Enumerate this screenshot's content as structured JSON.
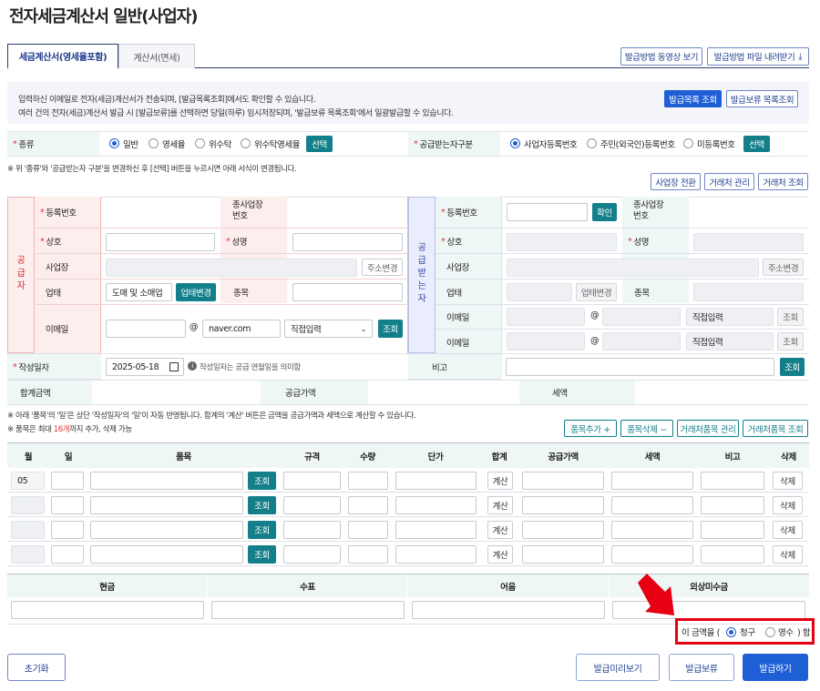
{
  "page": {
    "title": "전자세금계산서 일반(사업자)"
  },
  "tabs": [
    {
      "label": "세금계산서(영세율포함)"
    },
    {
      "label": "계산서(면세)"
    }
  ],
  "top_buttons": {
    "video": "발급방법 동영상 보기",
    "download": "발급방법 파일 내려받기"
  },
  "notice": {
    "line1": "입력하신 이메일로 전자(세금)계산서가 전송되며, [발급목록조회]에서도 확인할 수 있습니다.",
    "line2": "여러 건의 전자(세금)계산서 발급 시 [발급보류]를 선택하면 당일(하루) 임시저장되며, '발급보류 목록조회'에서 일괄발급할 수 있습니다.",
    "btn_list": "발급목록 조회",
    "btn_hold_list": "발급보류 목록조회"
  },
  "type_row": {
    "label": "종류",
    "options": [
      "일반",
      "영세율",
      "위수탁",
      "위수탁영세율"
    ],
    "select": "선택",
    "recv_label": "공급받는자구분",
    "recv_options": [
      "사업자등록번호",
      "주민(외국인)등록번호",
      "미등록번호"
    ],
    "recv_select": "선택"
  },
  "hint1": "※ 위 '종류'와 '공급받는자 구분'을 변경하신 후 [선택] 버튼을 누르시면 아래 서식이 변경됩니다.",
  "mid_buttons": {
    "biz_switch": "사업장 전환",
    "client_manage": "거래처 관리",
    "client_search": "거래처 조회"
  },
  "supplier": {
    "side": [
      "공",
      "급",
      "자"
    ],
    "reg_no": "등록번호",
    "sub_biz": "종사업장\n번호",
    "name": "상호",
    "ceo": "성명",
    "address": "사업장",
    "addr_btn": "주소변경",
    "biz_type": "업태",
    "biz_type_value": "도매 및 소매업",
    "biz_type_btn": "업태변경",
    "biz_item": "종목",
    "email": "이메일",
    "email_domain": "naver.com",
    "email_select": "직접입력",
    "email_btn": "조회"
  },
  "receiver": {
    "side": [
      "공",
      "급",
      "받",
      "는",
      "자"
    ],
    "reg_no": "등록번호",
    "confirm": "확인",
    "sub_biz": "종사업장\n번호",
    "name": "상호",
    "ceo": "성명",
    "address": "사업장",
    "addr_btn": "주소변경",
    "biz_type": "업태",
    "biz_type_btn": "업태변경",
    "biz_item": "종목",
    "email": "이메일",
    "email_select": "직접입력",
    "email_btn": "조회"
  },
  "write_date": {
    "label": "작성일자",
    "value": "2025-05-18",
    "note": "작성일자는 공급 연월일을 의미함",
    "remark_label": "비고",
    "remark_btn": "조회"
  },
  "totals": {
    "sum": "합계금액",
    "supply": "공급가액",
    "tax": "세액"
  },
  "hint2": "※ 아래 '품목'의 '일'은 상단 '작성일자'의 '일'이 자동 반영됩니다. 합계의 '계산' 버튼은 금액을 공급가액과 세액으로 계산할 수 있습니다.",
  "hint3_pre": "※ 품목은 최대 ",
  "hint3_num": "16개",
  "hint3_post": "까지 추가, 삭제 가능",
  "item_buttons": {
    "add": "품목추가 +",
    "del": "품목삭제 −",
    "manage": "거래처품목 관리",
    "search": "거래처품목 조회"
  },
  "items_table": {
    "headers": [
      "월",
      "일",
      "품목",
      "규격",
      "수량",
      "단가",
      "합계",
      "공급가액",
      "세액",
      "비고",
      "삭제"
    ],
    "rows": [
      {
        "month": "05"
      },
      {
        "month": ""
      },
      {
        "month": ""
      },
      {
        "month": ""
      }
    ],
    "lookup": "조회",
    "calc": "계산",
    "delete": "삭제"
  },
  "payment": {
    "headers": [
      "현금",
      "수표",
      "어음",
      "외상미수금"
    ]
  },
  "claim": {
    "pre": "이 금액을 (",
    "opt1": "청구",
    "opt2": "영수",
    "post": ") 함"
  },
  "bottom": {
    "reset": "초기화",
    "preview": "발급미리보기",
    "hold": "발급보류",
    "issue": "발급하기"
  },
  "colors": {
    "accent": "#1f5fd6",
    "teal": "#127f8a",
    "annotation": "#e60012"
  }
}
